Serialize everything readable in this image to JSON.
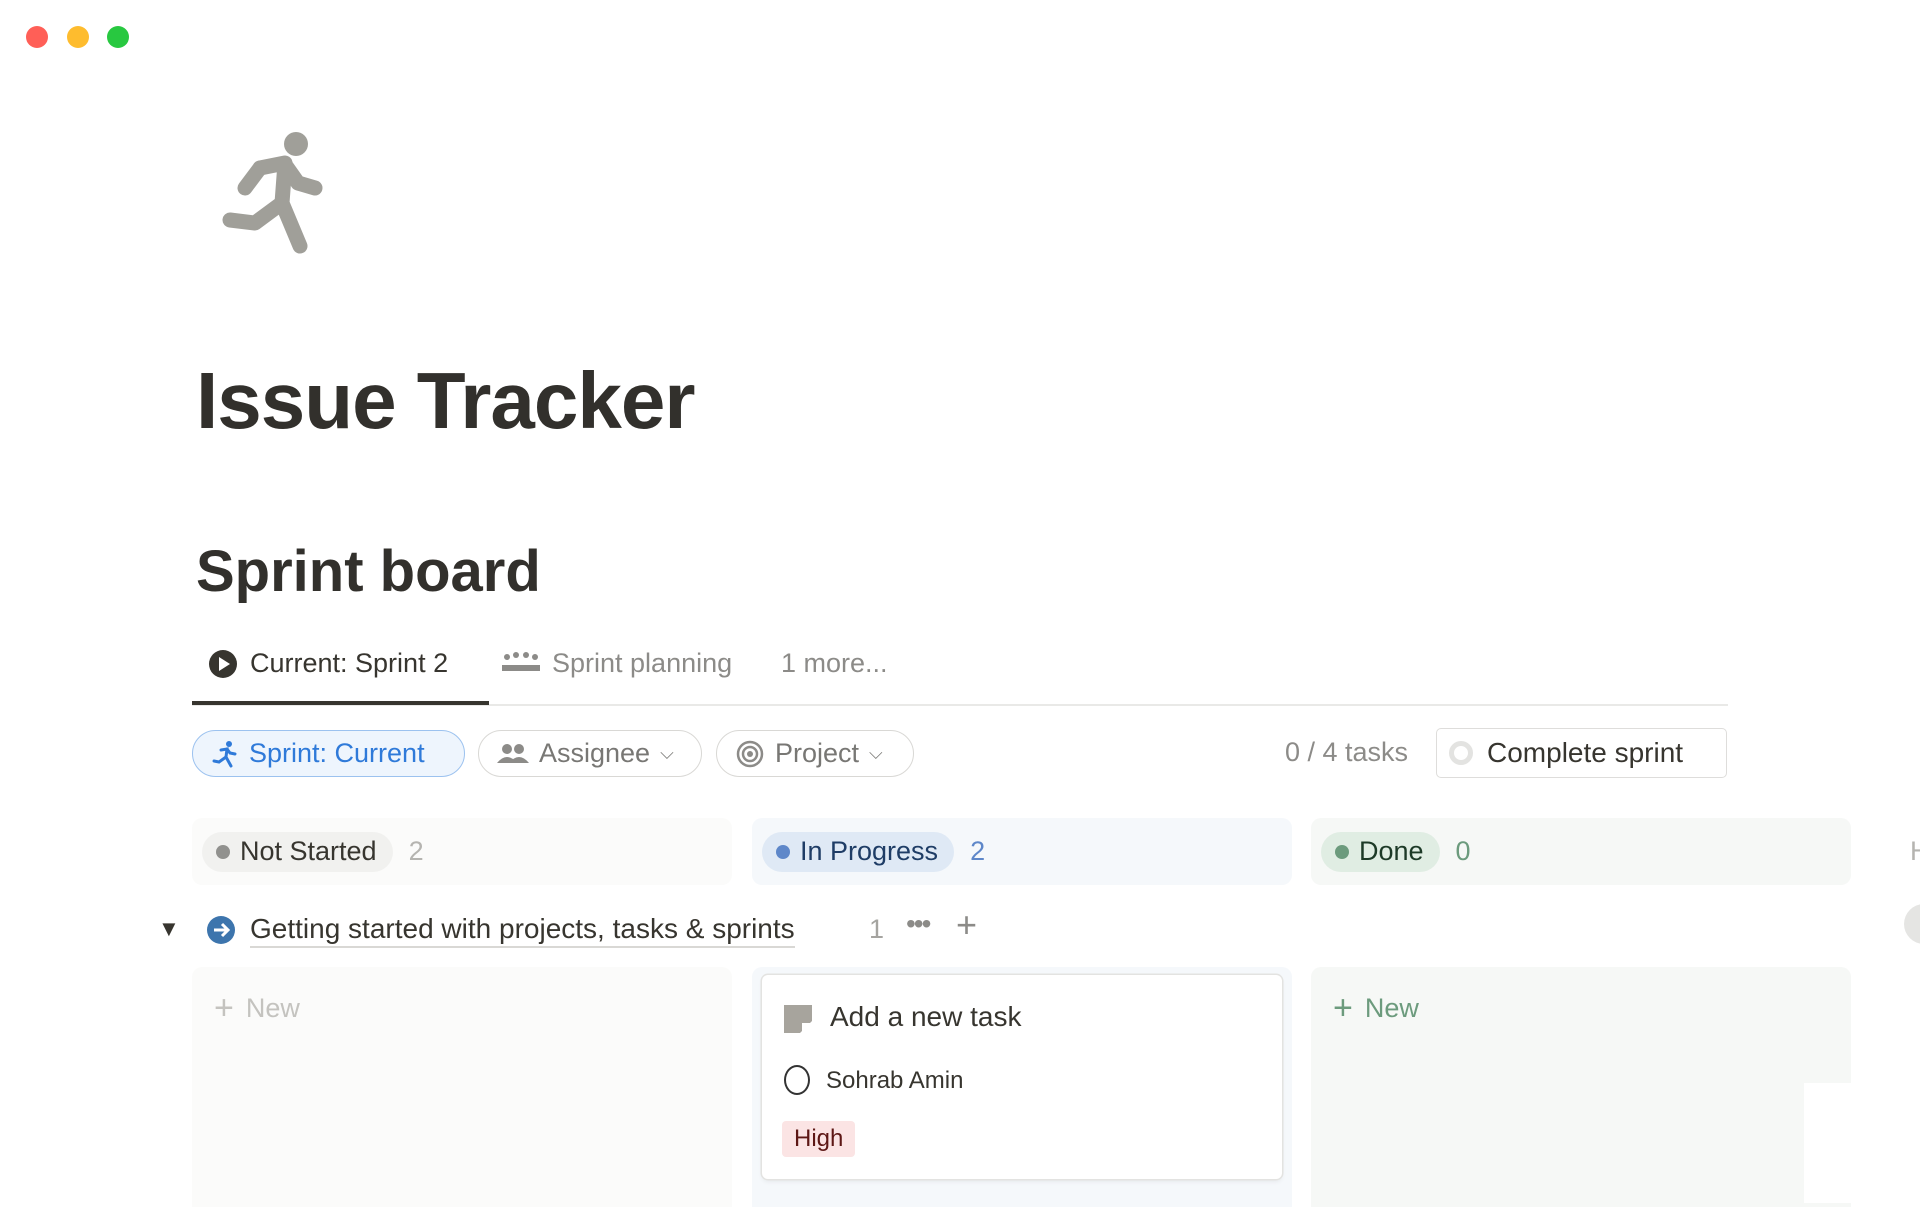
{
  "window": {
    "controls": [
      {
        "name": "close",
        "color": "#ff5f57"
      },
      {
        "name": "minimize",
        "color": "#febc2e"
      },
      {
        "name": "zoom",
        "color": "#28c840"
      }
    ]
  },
  "page": {
    "icon": "running-person-icon",
    "title": "Issue Tracker"
  },
  "section": {
    "title": "Sprint board"
  },
  "views": [
    {
      "label": "Current: Sprint 2",
      "icon": "play-circle-icon",
      "active": true
    },
    {
      "label": "Sprint planning",
      "icon": "team-icon"
    },
    {
      "label": "1 more..."
    }
  ],
  "filters": [
    {
      "label": "Sprint: Current",
      "icon": "running-person-icon"
    },
    {
      "label": "Assignee",
      "icon": "people-icon"
    },
    {
      "label": "Project",
      "icon": "target-icon"
    }
  ],
  "progress": {
    "label": "0 / 4 tasks"
  },
  "complete_button": {
    "label": "Complete sprint"
  },
  "columns": [
    {
      "label": "Not Started",
      "count": "2",
      "color": "#91918e"
    },
    {
      "label": "In Progress",
      "count": "2",
      "color": "#5e87c9"
    },
    {
      "label": "Done",
      "count": "0",
      "color": "#6c9b7d"
    }
  ],
  "hidden_column_peek": "H",
  "group": {
    "label": "Getting started with projects, tasks & sprints",
    "count": "1"
  },
  "new_label": "New",
  "card": {
    "title": "Add a new task",
    "assignee": "Sohrab Amin",
    "priority": "High"
  }
}
